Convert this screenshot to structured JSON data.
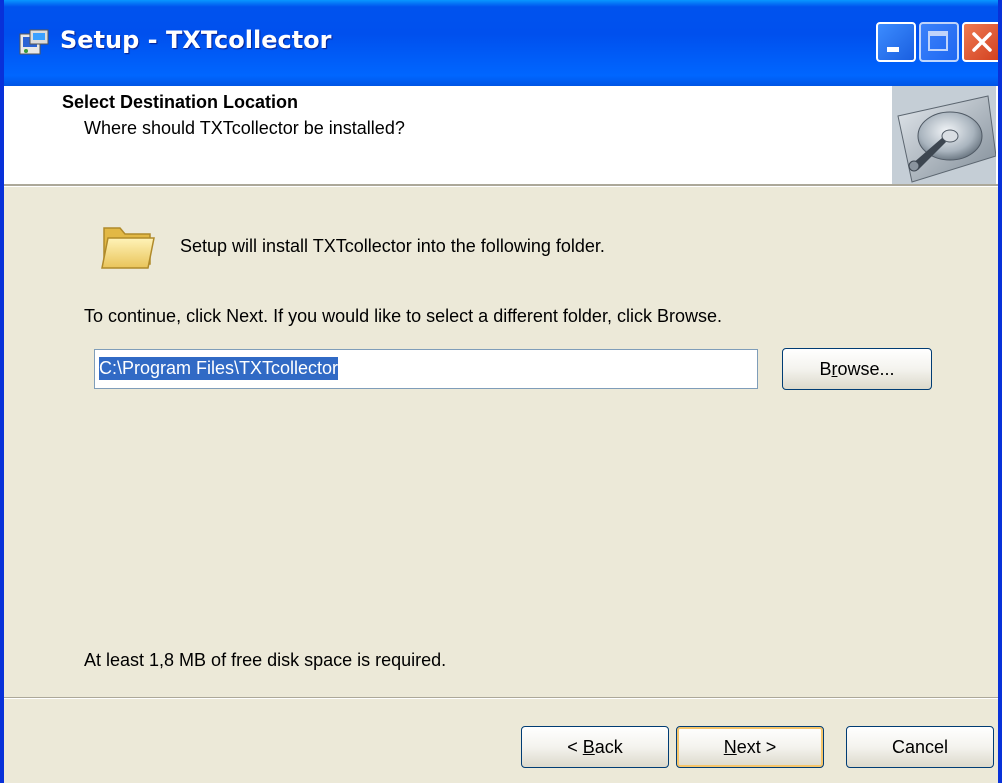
{
  "window": {
    "title": "Setup - TXTcollector"
  },
  "header": {
    "title": "Select Destination Location",
    "subtitle": "Where should TXTcollector be installed?"
  },
  "body": {
    "intro": "Setup will install TXTcollector into the following folder.",
    "instruction": "To continue, click Next. If you would like to select a different folder, click Browse.",
    "path_value": "C:\\Program Files\\TXTcollector",
    "space_note": "At least 1,8 MB of free disk space is required."
  },
  "buttons": {
    "browse_pre": "B",
    "browse_acc": "r",
    "browse_post": "owse...",
    "back_pre": "< ",
    "back_acc": "B",
    "back_post": "ack",
    "next_acc": "N",
    "next_post": "ext >",
    "cancel": "Cancel"
  },
  "icons": {
    "app": "setup-icon",
    "header_image": "hard-disk-icon",
    "folder": "folder-icon",
    "minimize": "minimize-icon",
    "maximize": "maximize-icon",
    "close": "close-icon"
  },
  "colors": {
    "titlebar": "#0054e3",
    "selection": "#316ac5",
    "dialog_bg": "#ece9d8",
    "close_button": "#d2401f"
  }
}
